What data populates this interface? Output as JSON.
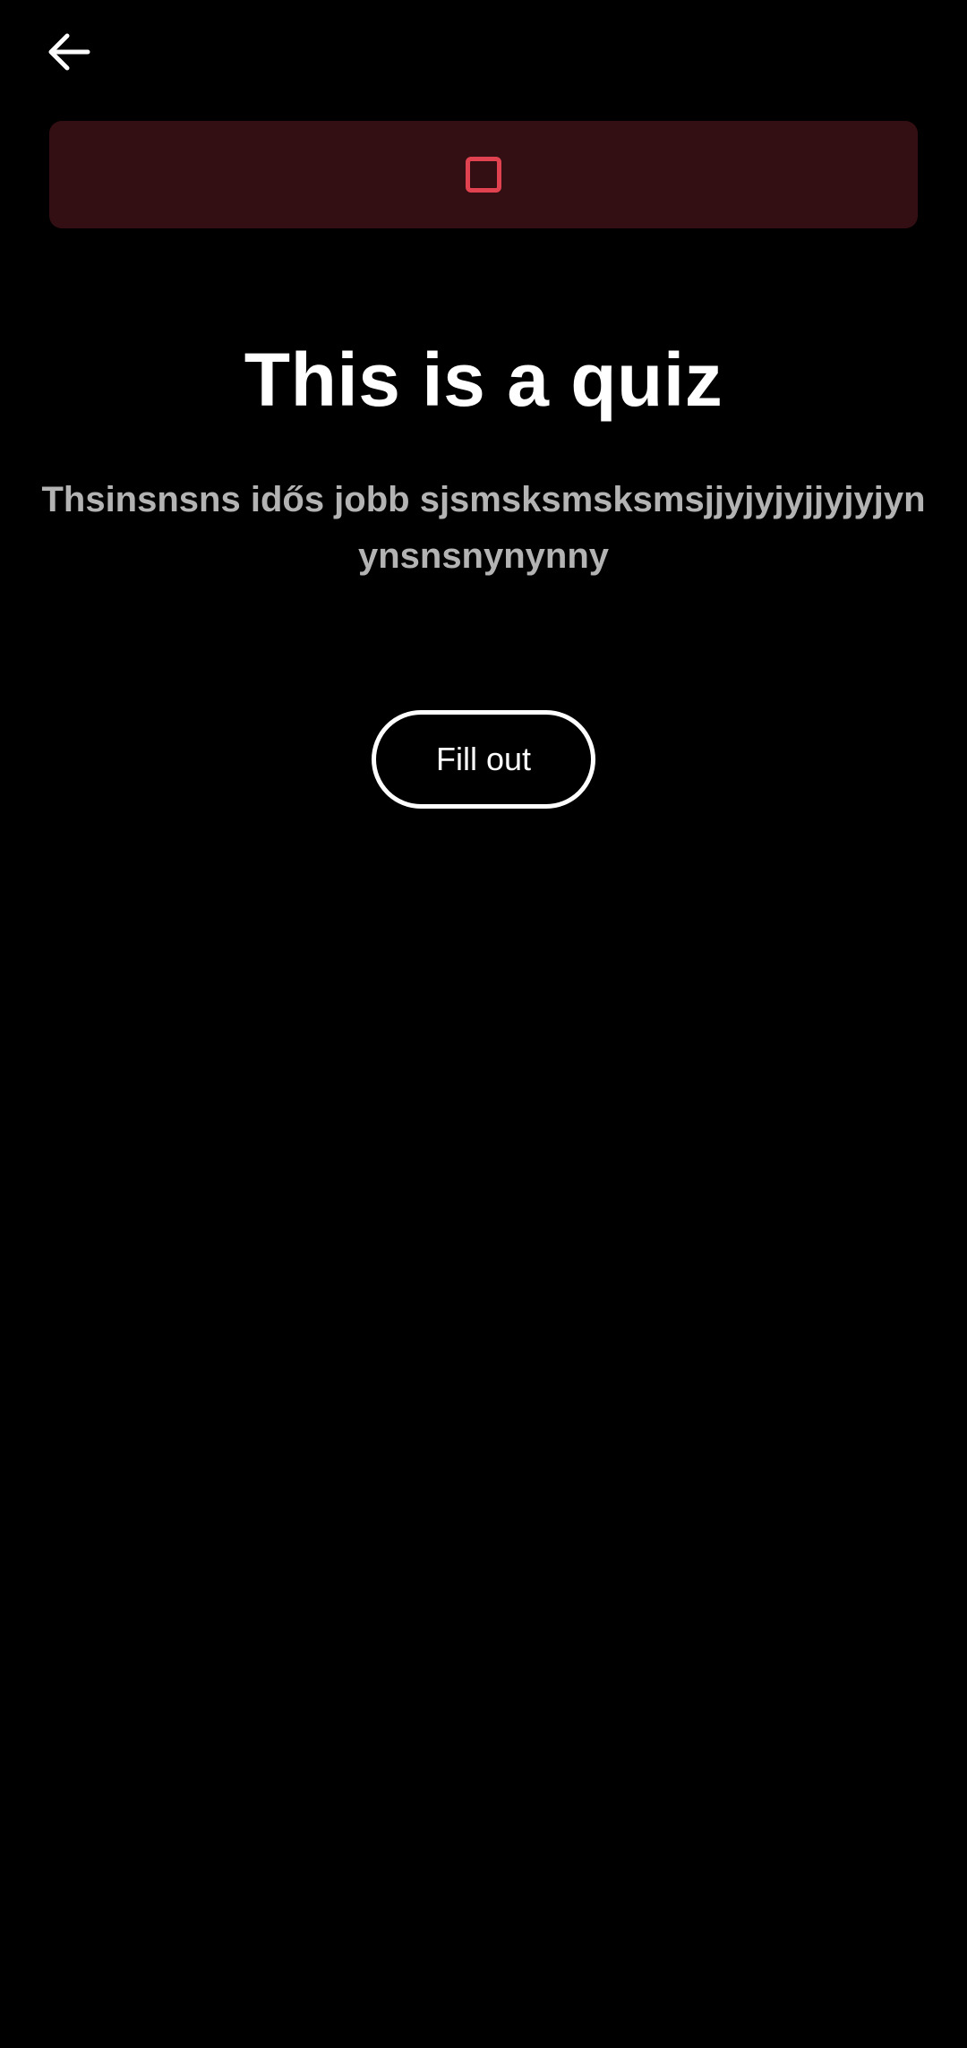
{
  "header": {
    "back_icon": "arrow-left-icon"
  },
  "banner": {
    "icon": "square-outline-icon",
    "background": "#330f13",
    "icon_color": "#e0434f"
  },
  "quiz": {
    "title": "This is a quiz",
    "description": "Thsinsnsns idős jobb sjsmsksmsksmsjjyjyjyjjyjyjynynsnsnynynny",
    "fill_out_label": "Fill out"
  }
}
